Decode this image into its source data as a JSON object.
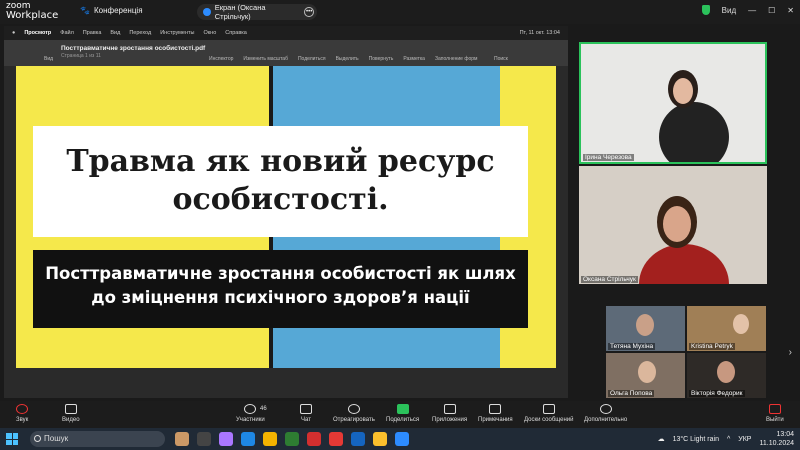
{
  "zoom": {
    "logo_line1": "zoom",
    "logo_line2": "Workplace",
    "meeting_label": "Конференція",
    "share_label": "Екран (Оксана Стрільчук)",
    "view_label": "Вид"
  },
  "mac_menu": {
    "apple": "",
    "app": "Просмотр",
    "items": [
      "Файл",
      "Правка",
      "Вид",
      "Переход",
      "Инструменты",
      "Окно",
      "Справка"
    ],
    "time": "Пт, 11 окт.  13:04"
  },
  "pdf": {
    "filename": "Посттравматичне зростання особистості.pdf",
    "page_info": "Страница 1 из 11",
    "view": "Вид",
    "tools": [
      "Инспектор",
      "Изменить масштаб",
      "Поделиться",
      "Выделить",
      "Повернуть",
      "Разметка",
      "Заполнение форм"
    ],
    "search": "Поиск"
  },
  "slide": {
    "title_line1": "Травма як новий ресурс",
    "title_line2": "особистості.",
    "subtitle_line1": "Посттравматичне зростання особистості як шлях",
    "subtitle_line2": "до зміцнення психічного здоров’я нації"
  },
  "participants": {
    "main": [
      {
        "name": "Ірина Черезова"
      },
      {
        "name": "Оксана Стрільчук"
      }
    ],
    "grid": [
      {
        "name": "Тетяна Мухіна"
      },
      {
        "name": "Kristina Petryk"
      },
      {
        "name": "Ольга Попова"
      },
      {
        "name": "Вікторія Федорик"
      }
    ]
  },
  "toolbar": {
    "audio": "Звук",
    "video": "Видео",
    "participants": "Участники",
    "participants_count": "46",
    "chat": "Чат",
    "react": "Отреагировать",
    "share": "Поделиться",
    "apps": "Приложения",
    "notes": "Примечания",
    "whiteboards": "Доски сообщений",
    "more": "Дополнительно",
    "leave": "Выйти"
  },
  "taskbar": {
    "search": "Пошук",
    "weather": "13°C  Light rain",
    "lang": "УКР",
    "time": "13:04",
    "date": "11.10.2024"
  },
  "colors": {
    "slide_yellow": "#f5e84b",
    "slide_blue": "#56a8d6",
    "zoom_green": "#2bc25b",
    "leave_red": "#e33333"
  }
}
